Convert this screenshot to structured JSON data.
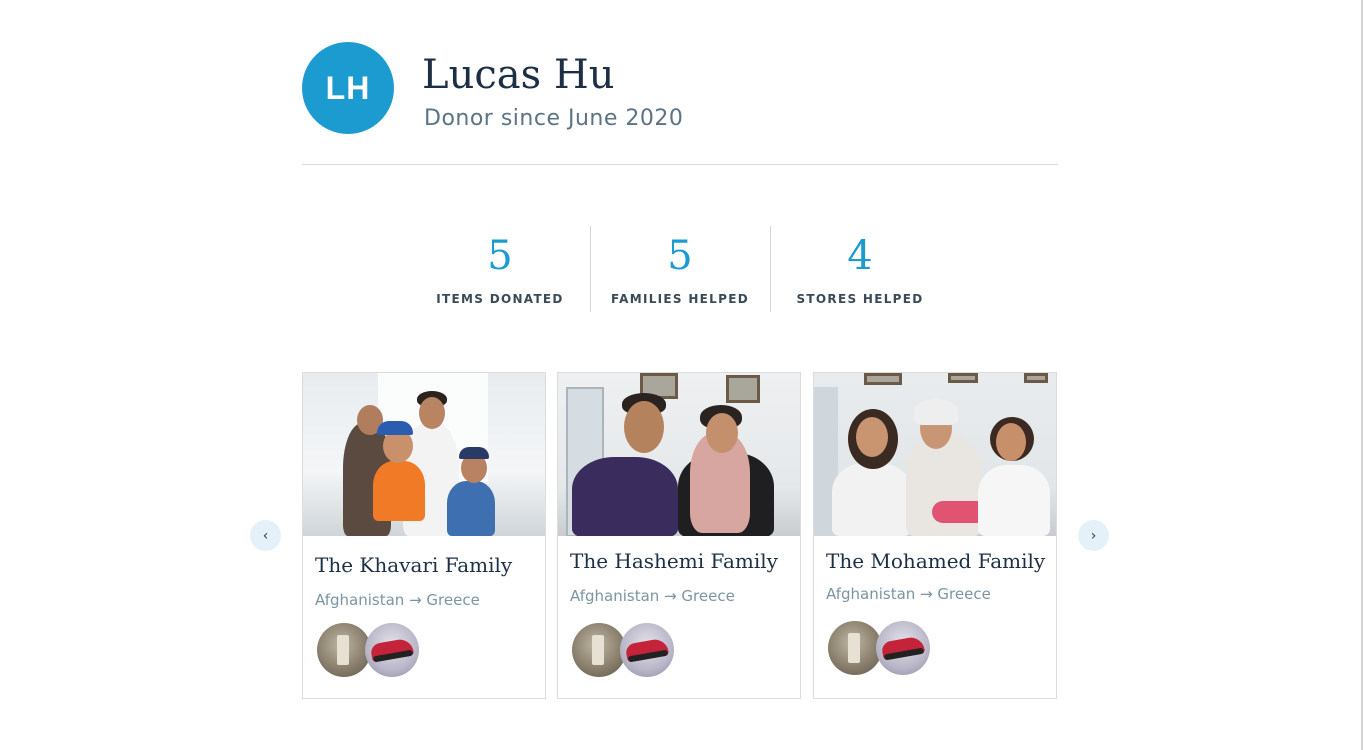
{
  "profile": {
    "initials": "LH",
    "name": "Lucas Hu",
    "since": "Donor since June 2020"
  },
  "stats": [
    {
      "value": "5",
      "label": "ITEMS DONATED"
    },
    {
      "value": "5",
      "label": "FAMILIES HELPED"
    },
    {
      "value": "4",
      "label": "STORES HELPED"
    }
  ],
  "carousel": {
    "prev_icon": "chevron-left-icon",
    "next_icon": "chevron-right-icon",
    "prev_glyph": "‹",
    "next_glyph": "›"
  },
  "families": [
    {
      "name": "The Khavari Family",
      "route": "Afghanistan → Greece",
      "items": [
        "stand-item",
        "shoe-item"
      ]
    },
    {
      "name": "The Hashemi Family",
      "route": "Afghanistan → Greece",
      "items": [
        "stand-item",
        "shoe-item"
      ]
    },
    {
      "name": "The Mohamed Family",
      "route": "Afghanistan → Greece",
      "items": [
        "stand-item",
        "shoe-item"
      ]
    }
  ],
  "colors": {
    "accent": "#1c9bd1",
    "heading": "#1c2f45",
    "muted": "#7b94a3"
  }
}
